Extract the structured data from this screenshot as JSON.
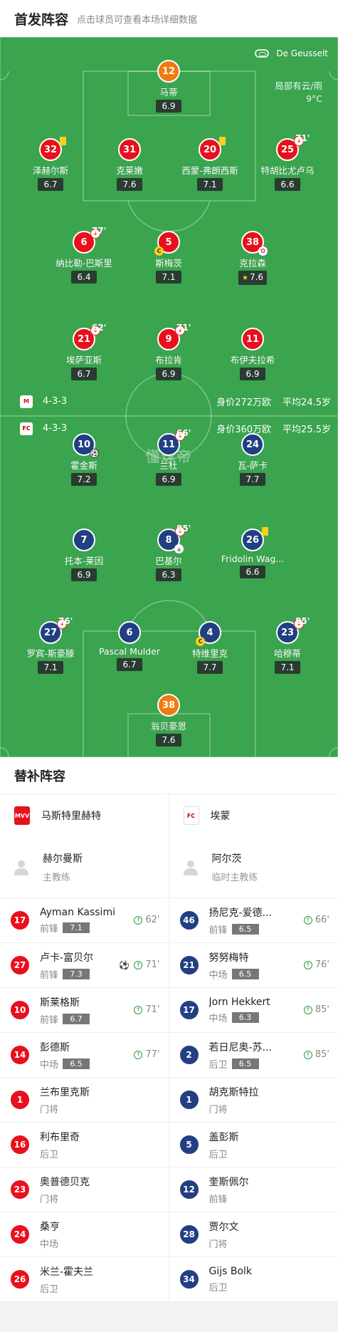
{
  "header": {
    "title": "首发阵容",
    "subtitle": "点击球员可查看本场详细数据"
  },
  "venue": {
    "stadium": "De Geusselt",
    "weather_line1": "局部有云/雨",
    "weather_line2": "9°C"
  },
  "watermark": "懂球帝",
  "home": {
    "formation": "4-3-3",
    "value": "身价272万欧",
    "avg_age": "平均24.5岁",
    "players": [
      {
        "num": "12",
        "name": "马蒂",
        "rating": "6.9",
        "color": "org"
      },
      {
        "num": "32",
        "name": "泽赫尔斯",
        "rating": "6.7",
        "yellow": true
      },
      {
        "num": "31",
        "name": "克莱嫩",
        "rating": "7.6"
      },
      {
        "num": "20",
        "name": "西蒙-弗朗西斯",
        "rating": "7.1",
        "yellow": true
      },
      {
        "num": "25",
        "name": "特胡比尤卢乌",
        "rating": "6.6",
        "sub": "71'"
      },
      {
        "num": "6",
        "name": "纳比勒-巴斯里",
        "rating": "6.4",
        "sub": "77'"
      },
      {
        "num": "5",
        "name": "斯梅茨",
        "rating": "7.1",
        "captain": true
      },
      {
        "num": "38",
        "name": "克拉森",
        "rating": "7.6",
        "star": true
      },
      {
        "num": "21",
        "name": "埃萨亚斯",
        "rating": "6.7",
        "sub": "62'"
      },
      {
        "num": "9",
        "name": "布拉肯",
        "rating": "6.9",
        "sub": "71'"
      },
      {
        "num": "11",
        "name": "布伊夫拉希",
        "rating": "6.9"
      }
    ]
  },
  "away": {
    "formation": "4-3-3",
    "value": "身价360万欧",
    "avg_age": "平均25.5岁",
    "players": [
      {
        "num": "10",
        "name": "霍金斯",
        "rating": "7.2",
        "goal": true
      },
      {
        "num": "11",
        "name": "兰杜",
        "rating": "6.9",
        "sub": "66'"
      },
      {
        "num": "24",
        "name": "瓦-萨卡",
        "rating": "7.7"
      },
      {
        "num": "7",
        "name": "托本-莱因",
        "rating": "6.9"
      },
      {
        "num": "8",
        "name": "巴基尔",
        "rating": "6.3",
        "sub": "85'",
        "assist": true
      },
      {
        "num": "26",
        "name": "Fridolin Wag...",
        "rating": "6.6",
        "yellow": true
      },
      {
        "num": "27",
        "name": "罗宾-斯豪滕",
        "rating": "7.1",
        "sub": "76'"
      },
      {
        "num": "6",
        "name": "Pascal Mulder",
        "rating": "6.7"
      },
      {
        "num": "4",
        "name": "特维里克",
        "rating": "7.7",
        "captain": true
      },
      {
        "num": "23",
        "name": "哈穆蒂",
        "rating": "7.1",
        "sub": "85'"
      },
      {
        "num": "38",
        "name": "翁贝豪恩",
        "rating": "7.6",
        "color": "org"
      }
    ]
  },
  "subs_section": {
    "title": "替补阵容"
  },
  "home_subs": {
    "team": "马斯特里赫特",
    "logo_text": "MVV",
    "coach": {
      "name": "赫尔曼斯",
      "role": "主教练"
    },
    "players": [
      {
        "num": "17",
        "name": "Ayman Kassimi",
        "pos": "前锋",
        "rating": "7.1",
        "sub": "62'"
      },
      {
        "num": "27",
        "name": "卢卡-富贝尔",
        "pos": "前锋",
        "rating": "7.3",
        "sub": "71'",
        "goal": true
      },
      {
        "num": "10",
        "name": "斯莱格斯",
        "pos": "前锋",
        "rating": "6.7",
        "sub": "71'"
      },
      {
        "num": "14",
        "name": "彭德斯",
        "pos": "中场",
        "rating": "6.5",
        "sub": "77'"
      },
      {
        "num": "1",
        "name": "兰布里克斯",
        "pos": "门将"
      },
      {
        "num": "16",
        "name": "利布里奇",
        "pos": "后卫"
      },
      {
        "num": "23",
        "name": "奥普德贝克",
        "pos": "门将"
      },
      {
        "num": "24",
        "name": "桑亨",
        "pos": "中场"
      },
      {
        "num": "26",
        "name": "米兰-霍夫兰",
        "pos": "后卫"
      }
    ]
  },
  "away_subs": {
    "team": "埃蒙",
    "logo_text": "FC",
    "coach": {
      "name": "阿尔茨",
      "role": "临时主教练"
    },
    "players": [
      {
        "num": "46",
        "name": "扬尼克-爱德...",
        "pos": "前锋",
        "rating": "6.5",
        "sub": "66'"
      },
      {
        "num": "21",
        "name": "努努梅特",
        "pos": "中场",
        "rating": "6.5",
        "sub": "76'"
      },
      {
        "num": "17",
        "name": "Jorn Hekkert",
        "pos": "中场",
        "rating": "6.3",
        "sub": "85'"
      },
      {
        "num": "2",
        "name": "若日尼奥-苏...",
        "pos": "后卫",
        "rating": "6.5",
        "sub": "85'"
      },
      {
        "num": "1",
        "name": "胡克斯特拉",
        "pos": "门将"
      },
      {
        "num": "5",
        "name": "盖彭斯",
        "pos": "后卫"
      },
      {
        "num": "12",
        "name": "奎斯佩尔",
        "pos": "前锋"
      },
      {
        "num": "28",
        "name": "贾尔文",
        "pos": "门将"
      },
      {
        "num": "34",
        "name": "Gijs Bolk",
        "pos": "后卫"
      }
    ]
  },
  "colors": {
    "pitch": "#3aa44e",
    "home": "#e8101c",
    "away": "#213f82",
    "keeper": "#f07a10"
  }
}
